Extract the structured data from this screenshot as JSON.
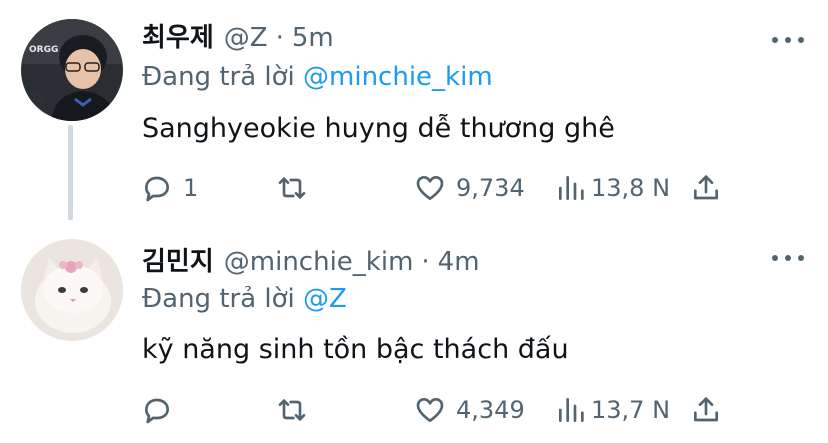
{
  "tweets": [
    {
      "name": "최우제",
      "handle": "@Z",
      "separator": "·",
      "time": "5m",
      "replying_prefix": "Đang trả lời",
      "replying_to": "@minchie_kim",
      "text": "Sanghyeokie huyng dễ thương ghê",
      "avatar_text": "ORGG",
      "replies": "1",
      "retweets": "",
      "likes": "9,734",
      "views": "13,8 N"
    },
    {
      "name": "김민지",
      "handle": "@minchie_kim",
      "separator": "·",
      "time": "4m",
      "replying_prefix": "Đang trả lời",
      "replying_to": "@Z",
      "text": "kỹ năng sinh tồn bậc thách đấu",
      "replies": "",
      "retweets": "",
      "likes": "4,349",
      "views": "13,7 N"
    }
  ],
  "colors": {
    "text": "#0f1419",
    "secondary": "#536471",
    "link": "#1d9bf0",
    "thread_line": "#cfd9de"
  },
  "icons": [
    "reply-icon",
    "retweet-icon",
    "like-icon",
    "views-icon",
    "share-icon",
    "more-icon"
  ]
}
